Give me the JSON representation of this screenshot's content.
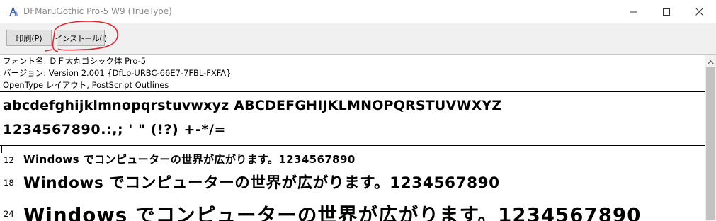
{
  "window": {
    "title": "DFMaruGothic Pro-5 W9 (TrueType)",
    "app_icon": "font-viewer-icon",
    "controls": [
      "minimize-icon",
      "maximize-icon",
      "close-icon"
    ]
  },
  "toolbar": {
    "print_label": "印刷(P)",
    "install_label": "インストール(I)"
  },
  "font_info": {
    "name_line": "フォント名: ＤＦ太丸ゴシック体 Pro-5",
    "version_line": "バージョン: Version 2.001 {DfLp-URBC-66E7-7FBL-FXFA}",
    "type_line": "OpenType レイアウト, PostScript Outlines"
  },
  "sample": {
    "alphabet": "abcdefghijklmnopqrstuvwxyz ABCDEFGHIJKLMNOPQRSTUVWXYZ",
    "digits": "1234567890.:,; ' \" (!?) +-*/="
  },
  "size_samples": [
    {
      "size": "12",
      "text": "Windows でコンピューターの世界が広がります。1234567890"
    },
    {
      "size": "18",
      "text": "Windows でコンピューターの世界が広がります。1234567890"
    },
    {
      "size": "24",
      "text": "Windows でコンピューターの世界が広がります。1234567890"
    }
  ],
  "colors": {
    "annotation": "#e8202a",
    "toolbar_bg": "#f0f0f0",
    "button_bg": "#e1e1e1",
    "title_text": "#8a8a8a"
  }
}
